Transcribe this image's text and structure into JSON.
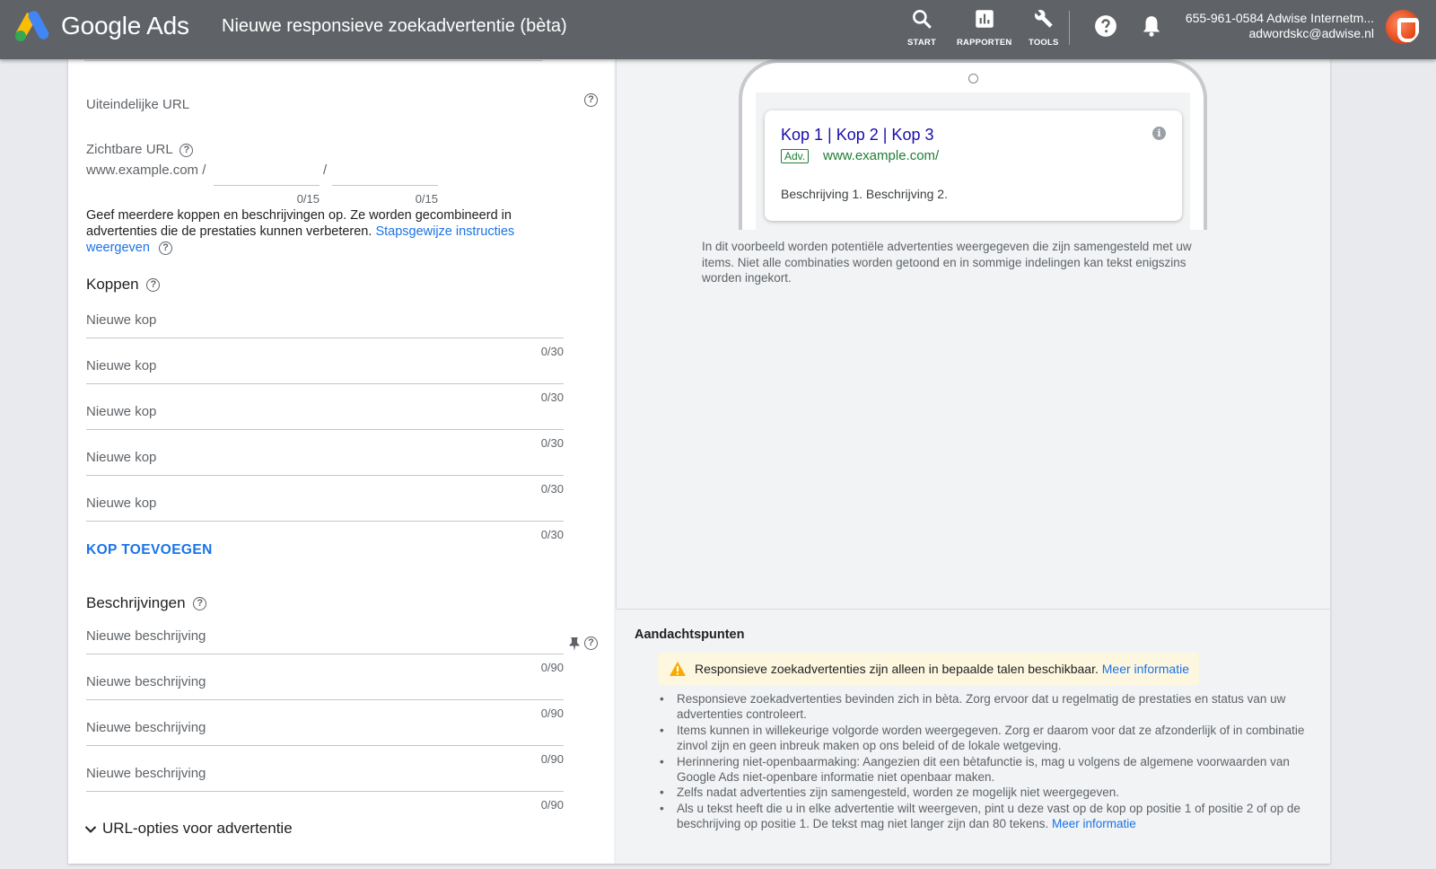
{
  "header": {
    "brand": "Google Ads",
    "title": "Nieuwe responsieve zoekadvertentie (bèta)",
    "nav": [
      {
        "label": "START",
        "icon": "search-icon"
      },
      {
        "label": "RAPPORTEN",
        "icon": "reports-icon"
      },
      {
        "label": "TOOLS",
        "icon": "wrench-icon"
      }
    ],
    "account_name": "655-961-0584 Adwise Internetm...",
    "account_email": "adwordskc@adwise.nl"
  },
  "form": {
    "final_url_label": "Uiteindelijke URL",
    "display_url_label": "Zichtbare URL",
    "display_url_domain": "www.example.com /",
    "display_url_sep": "/",
    "path1_counter": "0/15",
    "path2_counter": "0/15",
    "intro_text": "Geef meerdere koppen en beschrijvingen op. Ze worden gecombineerd in advertenties die de prestaties kunnen verbeteren.",
    "intro_link": "Stapsgewijze instructies weergeven",
    "headlines_title": "Koppen",
    "headlines": [
      {
        "placeholder": "Nieuwe kop",
        "counter": "0/30"
      },
      {
        "placeholder": "Nieuwe kop",
        "counter": "0/30"
      },
      {
        "placeholder": "Nieuwe kop",
        "counter": "0/30"
      },
      {
        "placeholder": "Nieuwe kop",
        "counter": "0/30"
      },
      {
        "placeholder": "Nieuwe kop",
        "counter": "0/30"
      }
    ],
    "add_headline": "KOP TOEVOEGEN",
    "descriptions_title": "Beschrijvingen",
    "descriptions": [
      {
        "placeholder": "Nieuwe beschrijving",
        "counter": "0/90"
      },
      {
        "placeholder": "Nieuwe beschrijving",
        "counter": "0/90"
      },
      {
        "placeholder": "Nieuwe beschrijving",
        "counter": "0/90"
      },
      {
        "placeholder": "Nieuwe beschrijving",
        "counter": "0/90"
      }
    ],
    "url_options": "URL-opties voor advertentie"
  },
  "preview": {
    "ad_title": "Kop 1 | Kop 2 | Kop 3",
    "ad_badge": "Adv.",
    "ad_url": "www.example.com/",
    "ad_description": "Beschrijving 1. Beschrijving 2.",
    "caption": "In dit voorbeeld worden potentiële advertenties weergegeven die zijn samengesteld met uw items. Niet alle combinaties worden getoond en in sommige indelingen kan tekst enigszins worden ingekort."
  },
  "notes": {
    "title": "Aandachtspunten",
    "warning": "Responsieve zoekadvertenties zijn alleen in bepaalde talen beschikbaar.",
    "warning_link": "Meer informatie",
    "items": [
      "Responsieve zoekadvertenties bevinden zich in bèta. Zorg ervoor dat u regelmatig de prestaties en status van uw advertenties controleert.",
      "Items kunnen in willekeurige volgorde worden weergegeven. Zorg er daarom voor dat ze afzonderlijk of in combinatie zinvol zijn en geen inbreuk maken op ons beleid of de lokale wetgeving.",
      "Herinnering niet-openbaarmaking: Aangezien dit een bètafunctie is, mag u volgens de algemene voorwaarden van Google Ads niet-openbare informatie niet openbaar maken.",
      "Zelfs nadat advertenties zijn samengesteld, worden ze mogelijk niet weergegeven.",
      "Als u tekst heeft die u in elke advertentie wilt weergeven, pint u deze vast op de kop op positie 1 of positie 2 of op de beschrijving op positie 1. De tekst mag niet langer zijn dan 80 tekens."
    ],
    "last_link": "Meer informatie"
  },
  "colors": {
    "header_bg": "#5f6368",
    "link": "#1a73e8",
    "ad_title": "#1a0dab",
    "ad_url": "#1e7e34",
    "warning_bg": "#fef7e0",
    "warning_icon": "#f9ab00"
  }
}
